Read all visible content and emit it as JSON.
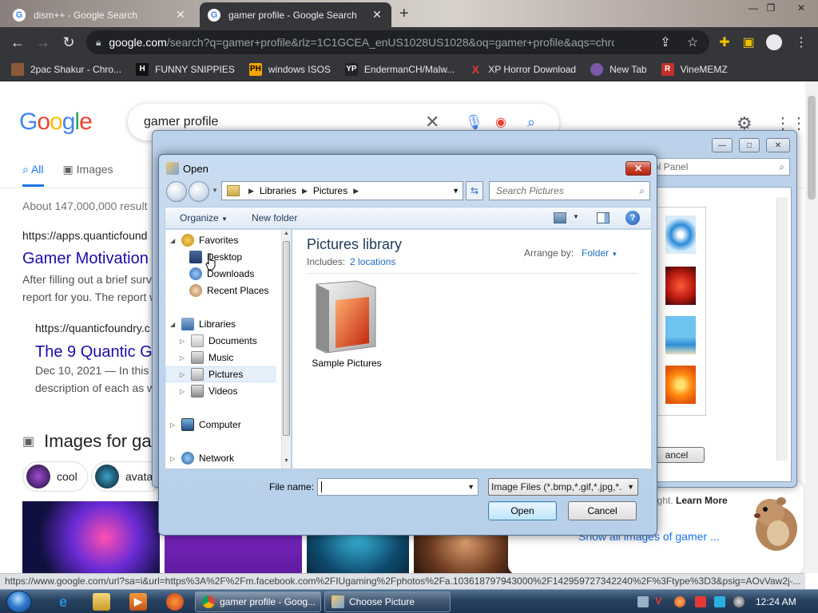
{
  "browser": {
    "tabs": [
      {
        "title": "dism++ - Google Search",
        "active": false
      },
      {
        "title": "gamer profile - Google Search",
        "active": true
      }
    ],
    "address": {
      "host": "google.com",
      "path": "/search?q=gamer+profile&rlz=1C1GCEA_enUS1028US1028&oq=gamer+profile&aqs=chrome...."
    },
    "bookmarks": [
      {
        "label": "2pac Shakur - Chro...",
        "icon": "2pac-icon",
        "color": "#8a5a3a",
        "glyph": ""
      },
      {
        "label": "FUNNY SNIPPIES",
        "icon": "h-icon",
        "color": "#111111",
        "glyph": "H"
      },
      {
        "label": "windows ISOS",
        "icon": "ph-icon",
        "color": "#f7a600",
        "glyph": "PH"
      },
      {
        "label": "EndermanCH/Malw...",
        "icon": "yp-icon",
        "color": "#222222",
        "glyph": "YP"
      },
      {
        "label": "XP Horror Download",
        "icon": "x-icon",
        "color": "#35363a",
        "glyph": "X"
      },
      {
        "label": "New Tab",
        "icon": "globe-icon",
        "color": "#7a5aa8",
        "glyph": ""
      },
      {
        "label": "VineMEMZ",
        "icon": "r-icon",
        "color": "#c4302b",
        "glyph": "R"
      }
    ],
    "status_url": "https://www.google.com/url?sa=i&url=https%3A%2F%2Fm.facebook.com%2FIUgaming%2Fphotos%2Fa.103618797943000%2F142959727342240%2F%3Ftype%3D3&psig=AOvVaw2j-..."
  },
  "google": {
    "logo": [
      "G",
      "o",
      "o",
      "g",
      "l",
      "e"
    ],
    "query": "gamer profile",
    "tabs": [
      "All",
      "Images"
    ],
    "stats": "About 147,000,000 result",
    "results": [
      {
        "url": "https://apps.quanticfound",
        "title": "Gamer Motivation",
        "snippet1": "After filling out a brief surv",
        "snippet2": "report for you. The report w"
      },
      {
        "url": "https://quanticfoundry.c",
        "title": "The 9 Quantic Ga",
        "snippet1": "Dec 10, 2021 — In this s",
        "snippet2": "description of each as w"
      }
    ],
    "images_heading": "Images for ga",
    "chips": [
      "cool",
      "avata"
    ],
    "copyright": "right.",
    "learn_more": "Learn More",
    "show_all": "Show all images of gamer ..."
  },
  "bg_window": {
    "search_text": "ol Panel",
    "cancel_label": "ancel"
  },
  "dialog": {
    "title": "Open",
    "breadcrumb": [
      "Libraries",
      "Pictures"
    ],
    "search_placeholder": "Search Pictures",
    "organize": "Organize",
    "new_folder": "New folder",
    "nav": {
      "favorites": "Favorites",
      "desktop": "Desktop",
      "downloads": "Downloads",
      "recent": "Recent Places",
      "libraries": "Libraries",
      "documents": "Documents",
      "music": "Music",
      "pictures": "Pictures",
      "videos": "Videos",
      "computer": "Computer",
      "network": "Network"
    },
    "library_title": "Pictures library",
    "includes_label": "Includes:",
    "includes_link": "2 locations",
    "arrange_label": "Arrange by:",
    "arrange_value": "Folder",
    "folder_label": "Sample Pictures",
    "file_name_label": "File name:",
    "file_name_value": "",
    "filter": "Image Files (*.bmp,*.gif,*.jpg,*.",
    "open_label": "Open",
    "cancel_label": "Cancel"
  },
  "taskbar": {
    "items": [
      "gamer profile - Goog...",
      "Choose Picture"
    ],
    "clock": "12:24 AM"
  }
}
